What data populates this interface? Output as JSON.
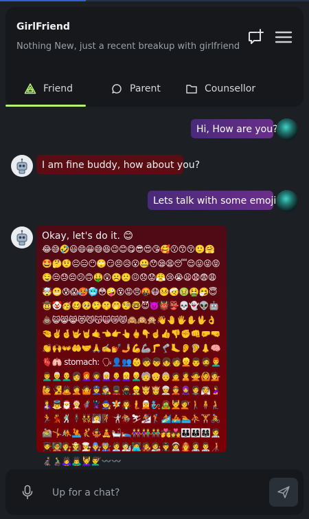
{
  "header": {
    "title": "GirlFriend",
    "subtitle": "Nothing New, just a recent breakup with girlfriend",
    "new_chat_icon": "new-message-icon",
    "menu_icon": "hamburger-menu-icon"
  },
  "tabs": [
    {
      "label": "Friend",
      "icon": "triangle-logo-icon",
      "active": true
    },
    {
      "label": "Parent",
      "icon": "chat-bubble-icon",
      "active": false
    },
    {
      "label": "Counsellor",
      "icon": "folder-icon",
      "active": false
    }
  ],
  "colors": {
    "accent": "#b6f07a",
    "outgoing_bubble": "#5b2d86",
    "incoming_bubble": "#5a0d13",
    "background": "#1c1f24"
  },
  "messages": [
    {
      "from": "user",
      "text": "Hi, How are you?"
    },
    {
      "from": "bot",
      "text": "I am fine buddy, how about you?"
    },
    {
      "from": "user",
      "text": "Lets talk with some emojis ."
    },
    {
      "from": "bot",
      "text": "Okay, let's do it. 😊",
      "emoji_text": "😂😅🤣😃😄😀😅😆😉😊😋😎😍😘🥰😗😙😚🙂🤗🤩🤔🤨😐😑😶🙄😏😣😥😮🤐😯😪😫😴😌😛😜😝🤤😒😓😔😕🙃🤑😲☹️🙁😖😞😟😤😢😭😦😧😨😩🤯😬😰😱🥵🥶😳🤪😵😡😠🤬😷🤒🤕🤢🤮🤧😇🤠🤡🥳🥴🥺🤥🤫🤭🧐🤓😈👿👹👺💀👻👽🤖💩😺😸😹😻😼😽🙀😿😾🙈🙉🙊👋🤚🖐✋🖖👌🤏✌️🤞🤟🤘🤙👈👉👆🖕👇☝️👍👎✊👊🤛🤜👏🙌👐🤲🤝🙏✍️💅🤳💪🦾🦵🦿🦶👂🦻👃🧠🫀🫁 stomach: 🗣👤👥👶🧒👦👧🧑👱👨🧔👨‍🦰👨‍🦱👨‍🦳👨‍🦲👩👩‍🦰👩‍🦱👩‍🦳👩‍🦲👱‍♀️👱‍♂️🧓👴👵🙍🙎🙅🙆💁🙋🧏🙇🤦🤷👮🕵️💂🥷👷🤴👸👳👲🧕🤵👰🤰🤱👼🎅🤶🦸🦹🧙🧚🧛🧜🧝🧞🧟💆💇🚶🧍🧎🏃💃🕺🕴👯🧖🧗🤺🏇⛷🏂🏌🏄🚣🏊⛹🏋🚴🚵🤸🤼🤽🤾🤹🧘🛀🛌👭👫👬💏💑👪👨‍👩‍👦👩‍👩‍👧🧑‍⚕️🧑‍🎓🧑‍🏫🧑‍⚖️🧑‍🌾🧑‍🍳🧑‍🔧🧑‍🏭🧑‍💼🧑‍🔬🧑‍💻🧑‍🎤🧑‍🎨🧑‍✈️🧑‍🚀🧑‍🚒👩‍⚕️👨‍⚕️🧑‍🦯👩‍🦼👨‍🦽🙇‍♀️🙇‍♂️💆‍♀️💇‍♂️〰️〰️"
    }
  ],
  "composer": {
    "placeholder": "Up for a chat?",
    "mic_icon": "microphone-icon",
    "send_icon": "send-icon"
  }
}
